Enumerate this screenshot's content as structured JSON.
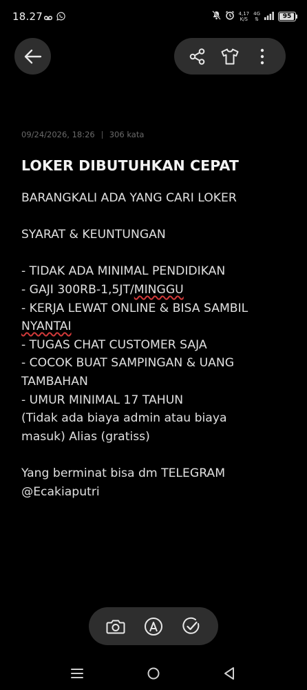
{
  "status_bar": {
    "time": "18.27",
    "left_icons": [
      "voicemail-icon",
      "whatsapp-icon"
    ],
    "right_icons": [
      "mute-icon",
      "alarm-icon",
      "network-speed",
      "4g-icon",
      "signal-icon",
      "battery-icon"
    ],
    "net_speed_value": "4,17",
    "net_speed_unit": "K/S",
    "network_type": "4G",
    "battery_level": "95"
  },
  "toolbar": {
    "back_icon": "arrow-left-icon",
    "share_icon": "share-icon",
    "theme_icon": "tshirt-icon",
    "more_icon": "more-vertical-icon"
  },
  "note": {
    "date": "09/24/2026, 18:26",
    "word_count": "306 kata",
    "title": "LOKER DIBUTUHKAN CEPAT",
    "lines": [
      {
        "text": "BARANGKALI ADA YANG CARI LOKER"
      },
      {
        "text": ""
      },
      {
        "text": "SYARAT & KEUNTUNGAN"
      },
      {
        "text": ""
      },
      {
        "text": "- TIDAK ADA MINIMAL PENDIDIKAN"
      },
      {
        "text": "- GAJI 300RB-1,5JT/",
        "flagged": "MINGGU"
      },
      {
        "text": "- KERJA LEWAT ONLINE & BISA SAMBIL"
      },
      {
        "text": "",
        "flagged": "NYANTAI"
      },
      {
        "text": "- TUGAS CHAT CUSTOMER SAJA"
      },
      {
        "text": "- COCOK BUAT SAMPINGAN & UANG"
      },
      {
        "text": "TAMBAHAN"
      },
      {
        "text": "- UMUR MINIMAL 17 TAHUN"
      },
      {
        "text": "(Tidak ada biaya admin atau biaya"
      },
      {
        "text": "masuk) Alias (gratiss)"
      },
      {
        "text": ""
      },
      {
        "text": "Yang berminat bisa dm TELEGRAM"
      },
      {
        "text": "@Ecakiaputri"
      }
    ]
  },
  "bottom_toolbar": {
    "camera_icon": "camera-icon",
    "handwriting_icon": "pen-icon",
    "checklist_icon": "checklist-icon"
  },
  "nav_bar": {
    "recents_icon": "menu-icon",
    "home_icon": "home-icon",
    "back_icon": "back-triangle-icon"
  }
}
